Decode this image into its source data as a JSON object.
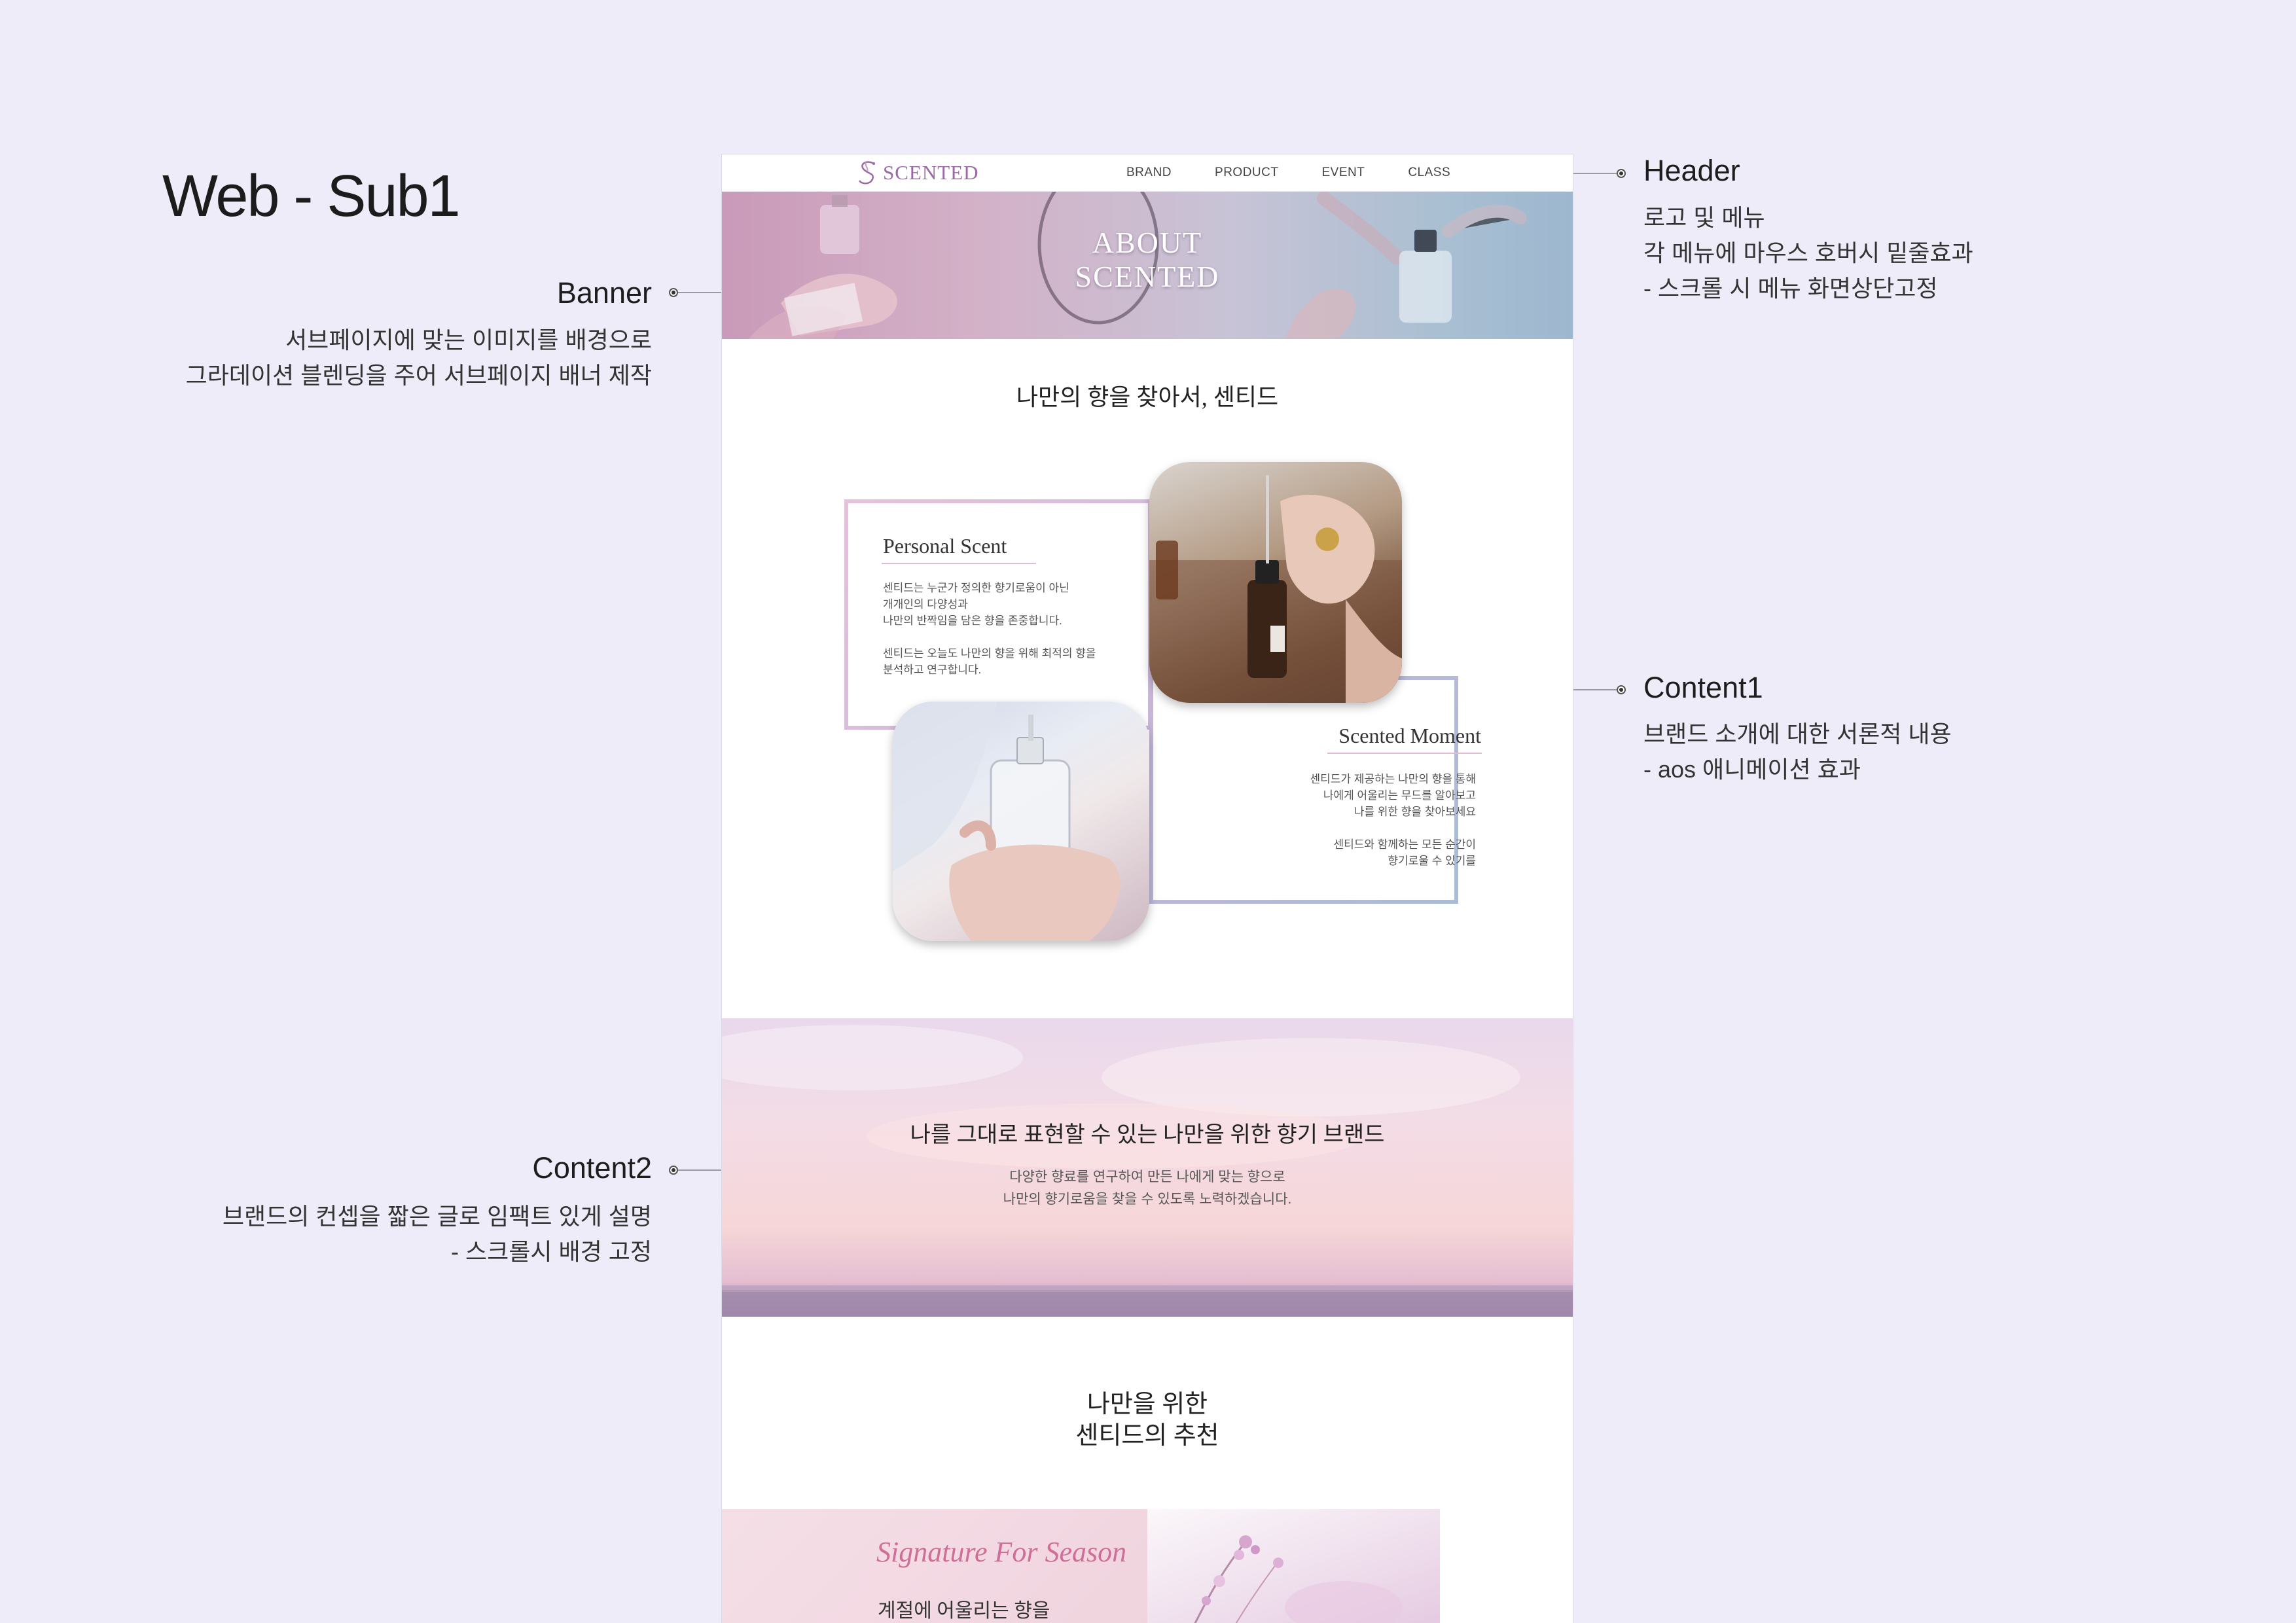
{
  "page_title": "Web - Sub1",
  "annotations": {
    "banner": {
      "title": "Banner",
      "desc": "서브페이지에 맞는 이미지를 배경으로\n그라데이션 블렌딩을 주어 서브페이지 배너 제작"
    },
    "content2": {
      "title": "Content2",
      "desc": "브랜드의 컨셉을 짧은 글로 임팩트 있게 설명\n-  스크롤시 배경 고정"
    },
    "header": {
      "title": "Header",
      "desc": "로고 및 메뉴\n각 메뉴에 마우스 호버시 밑줄효과\n- 스크롤 시 메뉴 화면상단고정"
    },
    "content1": {
      "title": "Content1",
      "desc": "브랜드 소개에 대한 서론적 내용\n- aos 애니메이션 효과"
    }
  },
  "header": {
    "logo": "SCENTED",
    "nav": [
      "BRAND",
      "PRODUCT",
      "EVENT",
      "CLASS"
    ]
  },
  "banner": {
    "title": "ABOUT\nSCENTED"
  },
  "content1": {
    "title": "나만의 향을 찾아서, 센티드",
    "card1": {
      "heading": "Personal Scent",
      "text": "센티드는 누군가 정의한 향기로움이 아닌\n개개인의 다양성과\n나만의 반짝임을 담은 향을 존중합니다.\n\n센티드는 오늘도 나만의 향을 위해 최적의 향을\n분석하고 연구합니다."
    },
    "card2": {
      "heading": "Scented Moment",
      "text": "센티드가 제공하는 나만의 향을 통해\n나에게 어울리는 무드를 알아보고\n나를 위한 향을 찾아보세요\n\n센티드와 함께하는 모든 순간이\n향기로울 수 있기를"
    }
  },
  "content2": {
    "title": "나를 그대로 표현할 수 있는 나만을 위한 향기 브랜드",
    "text": "다양한 향료를 연구하여 만든 나에게 맞는 향으로\n나만의 향기로움을 찾을 수 있도록 노력하겠습니다."
  },
  "content3": {
    "title": "나만을 위한\n센티드의 추천",
    "signature_title": "Signature For Season",
    "signature_sub": "계절에 어울리는 향을"
  },
  "colors": {
    "background": "#efecfa",
    "logo": "#9b6aa6",
    "signature": "#cf6f98"
  }
}
